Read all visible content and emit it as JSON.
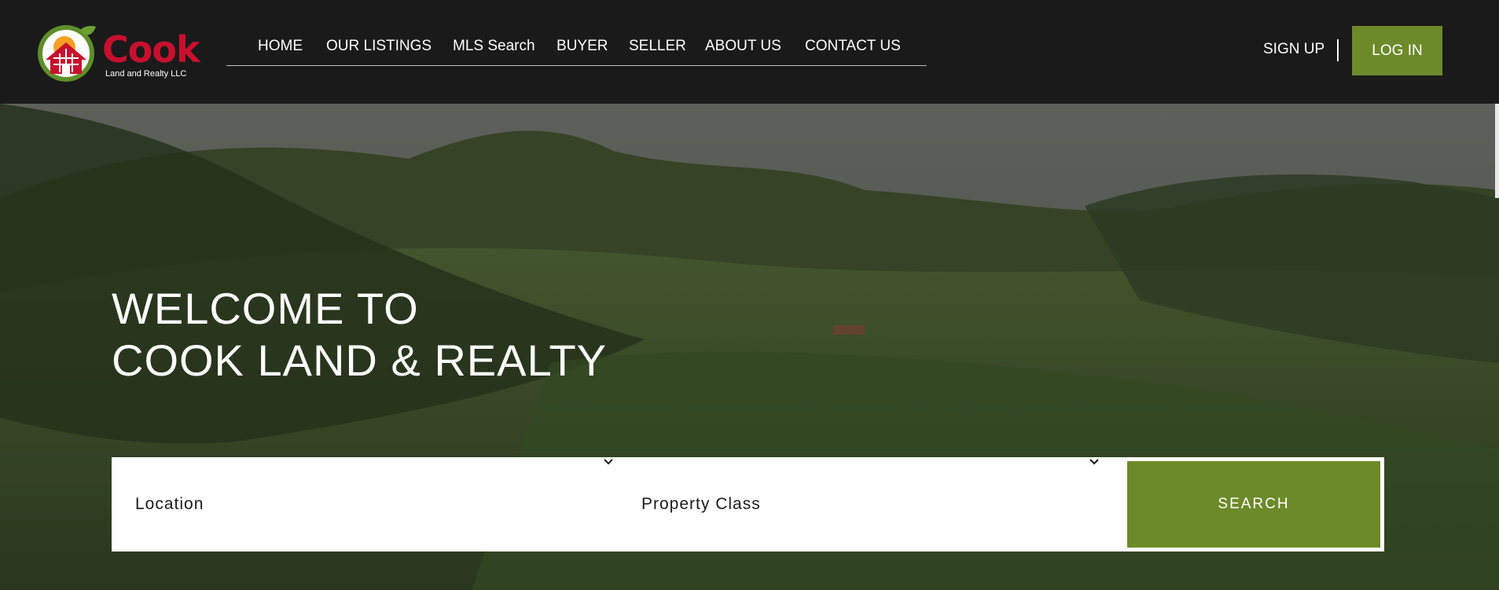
{
  "logo": {
    "word": "Cook",
    "subtitle": "Land and Realty LLC",
    "colors": {
      "red": "#c8102e",
      "green": "#6c8a29"
    }
  },
  "nav": {
    "items": [
      {
        "label": "HOME"
      },
      {
        "label": "OUR LISTINGS"
      },
      {
        "label": "MLS Search"
      },
      {
        "label": "BUYER"
      },
      {
        "label": "SELLER"
      },
      {
        "label": "ABOUT US"
      },
      {
        "label": "CONTACT US"
      }
    ]
  },
  "auth": {
    "signup_label": "SIGN UP",
    "login_label": "LOG IN"
  },
  "hero": {
    "title_line1": "WELCOME TO",
    "title_line2": "COOK LAND & REALTY",
    "background_icon": "green-valley-landscape"
  },
  "search": {
    "location": {
      "selected": "Location",
      "icon": "chevron-down-icon"
    },
    "property_class": {
      "selected": "Property Class",
      "icon": "chevron-down-icon"
    },
    "button_label": "SEARCH"
  },
  "theme": {
    "header_bg": "#1a1a1a",
    "accent": "#6c8a29",
    "text_light": "#ffffff"
  }
}
